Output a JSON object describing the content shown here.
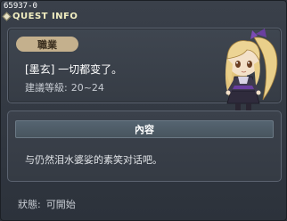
{
  "quest_id": "65937-0",
  "window": {
    "title": "QUEST INFO"
  },
  "info": {
    "job_badge": "職業",
    "quest_name": "[墨玄] 一切都变了。",
    "level_label": "建議等級:",
    "level_range": "20~24"
  },
  "content": {
    "header": "內容",
    "text": "与仍然泪水婆娑的素笑对话吧。"
  },
  "status": {
    "label": "狀態:",
    "value": "可開始"
  },
  "colors": {
    "title_text": "#f2eec1",
    "badge": "#c4b08d",
    "panel_border": "#5b6370",
    "content_header": "#556471"
  },
  "icons": {
    "title_bullet": "diamond-bullet-icon",
    "portrait": "character-portrait"
  }
}
